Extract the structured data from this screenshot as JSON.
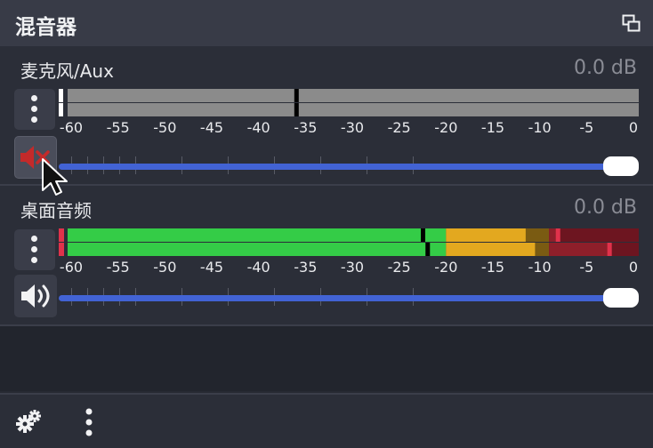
{
  "panel": {
    "title": "混音器",
    "undock_icon": "undock-icon"
  },
  "colors": {
    "green": "#34cc47",
    "yellow": "#e3a81f",
    "red": "#8e1f2a",
    "peak": "#e0324b",
    "slider": "#4263d4",
    "muted_icon": "#c42a2a"
  },
  "scale_labels": [
    "-60",
    "-55",
    "-50",
    "-45",
    "-40",
    "-35",
    "-30",
    "-25",
    "-20",
    "-15",
    "-10",
    "-5",
    "0"
  ],
  "channels": [
    {
      "name": "麦克风/Aux",
      "db": "0.0 dB",
      "muted": true,
      "volume_icon": "speaker-muted-icon",
      "volume_level": 1.0,
      "meter_rows": [
        {
          "level_db": -60,
          "peak_hold_db": -36
        },
        {
          "level_db": -60,
          "peak_hold_db": -36
        }
      ]
    },
    {
      "name": "桌面音频",
      "db": "0.0 dB",
      "muted": false,
      "volume_icon": "speaker-icon",
      "volume_level": 1.0,
      "meter_rows": [
        {
          "level_db": -22.5,
          "peak_hold_db": -22.5,
          "clip": -8
        },
        {
          "level_db": -22,
          "peak_hold_db": -22,
          "clip": -2.5
        }
      ]
    }
  ],
  "footer": {
    "settings_icon": "gears-icon",
    "menu_icon": "vertical-dots-icon"
  }
}
